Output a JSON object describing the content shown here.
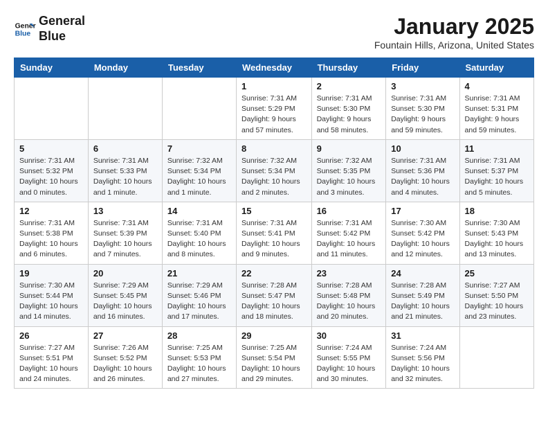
{
  "logo": {
    "line1": "General",
    "line2": "Blue"
  },
  "title": "January 2025",
  "subtitle": "Fountain Hills, Arizona, United States",
  "weekdays": [
    "Sunday",
    "Monday",
    "Tuesday",
    "Wednesday",
    "Thursday",
    "Friday",
    "Saturday"
  ],
  "weeks": [
    [
      {
        "day": "",
        "info": ""
      },
      {
        "day": "",
        "info": ""
      },
      {
        "day": "",
        "info": ""
      },
      {
        "day": "1",
        "info": "Sunrise: 7:31 AM\nSunset: 5:29 PM\nDaylight: 9 hours and 57 minutes."
      },
      {
        "day": "2",
        "info": "Sunrise: 7:31 AM\nSunset: 5:30 PM\nDaylight: 9 hours and 58 minutes."
      },
      {
        "day": "3",
        "info": "Sunrise: 7:31 AM\nSunset: 5:30 PM\nDaylight: 9 hours and 59 minutes."
      },
      {
        "day": "4",
        "info": "Sunrise: 7:31 AM\nSunset: 5:31 PM\nDaylight: 9 hours and 59 minutes."
      }
    ],
    [
      {
        "day": "5",
        "info": "Sunrise: 7:31 AM\nSunset: 5:32 PM\nDaylight: 10 hours and 0 minutes."
      },
      {
        "day": "6",
        "info": "Sunrise: 7:31 AM\nSunset: 5:33 PM\nDaylight: 10 hours and 1 minute."
      },
      {
        "day": "7",
        "info": "Sunrise: 7:32 AM\nSunset: 5:34 PM\nDaylight: 10 hours and 1 minute."
      },
      {
        "day": "8",
        "info": "Sunrise: 7:32 AM\nSunset: 5:34 PM\nDaylight: 10 hours and 2 minutes."
      },
      {
        "day": "9",
        "info": "Sunrise: 7:32 AM\nSunset: 5:35 PM\nDaylight: 10 hours and 3 minutes."
      },
      {
        "day": "10",
        "info": "Sunrise: 7:31 AM\nSunset: 5:36 PM\nDaylight: 10 hours and 4 minutes."
      },
      {
        "day": "11",
        "info": "Sunrise: 7:31 AM\nSunset: 5:37 PM\nDaylight: 10 hours and 5 minutes."
      }
    ],
    [
      {
        "day": "12",
        "info": "Sunrise: 7:31 AM\nSunset: 5:38 PM\nDaylight: 10 hours and 6 minutes."
      },
      {
        "day": "13",
        "info": "Sunrise: 7:31 AM\nSunset: 5:39 PM\nDaylight: 10 hours and 7 minutes."
      },
      {
        "day": "14",
        "info": "Sunrise: 7:31 AM\nSunset: 5:40 PM\nDaylight: 10 hours and 8 minutes."
      },
      {
        "day": "15",
        "info": "Sunrise: 7:31 AM\nSunset: 5:41 PM\nDaylight: 10 hours and 9 minutes."
      },
      {
        "day": "16",
        "info": "Sunrise: 7:31 AM\nSunset: 5:42 PM\nDaylight: 10 hours and 11 minutes."
      },
      {
        "day": "17",
        "info": "Sunrise: 7:30 AM\nSunset: 5:42 PM\nDaylight: 10 hours and 12 minutes."
      },
      {
        "day": "18",
        "info": "Sunrise: 7:30 AM\nSunset: 5:43 PM\nDaylight: 10 hours and 13 minutes."
      }
    ],
    [
      {
        "day": "19",
        "info": "Sunrise: 7:30 AM\nSunset: 5:44 PM\nDaylight: 10 hours and 14 minutes."
      },
      {
        "day": "20",
        "info": "Sunrise: 7:29 AM\nSunset: 5:45 PM\nDaylight: 10 hours and 16 minutes."
      },
      {
        "day": "21",
        "info": "Sunrise: 7:29 AM\nSunset: 5:46 PM\nDaylight: 10 hours and 17 minutes."
      },
      {
        "day": "22",
        "info": "Sunrise: 7:28 AM\nSunset: 5:47 PM\nDaylight: 10 hours and 18 minutes."
      },
      {
        "day": "23",
        "info": "Sunrise: 7:28 AM\nSunset: 5:48 PM\nDaylight: 10 hours and 20 minutes."
      },
      {
        "day": "24",
        "info": "Sunrise: 7:28 AM\nSunset: 5:49 PM\nDaylight: 10 hours and 21 minutes."
      },
      {
        "day": "25",
        "info": "Sunrise: 7:27 AM\nSunset: 5:50 PM\nDaylight: 10 hours and 23 minutes."
      }
    ],
    [
      {
        "day": "26",
        "info": "Sunrise: 7:27 AM\nSunset: 5:51 PM\nDaylight: 10 hours and 24 minutes."
      },
      {
        "day": "27",
        "info": "Sunrise: 7:26 AM\nSunset: 5:52 PM\nDaylight: 10 hours and 26 minutes."
      },
      {
        "day": "28",
        "info": "Sunrise: 7:25 AM\nSunset: 5:53 PM\nDaylight: 10 hours and 27 minutes."
      },
      {
        "day": "29",
        "info": "Sunrise: 7:25 AM\nSunset: 5:54 PM\nDaylight: 10 hours and 29 minutes."
      },
      {
        "day": "30",
        "info": "Sunrise: 7:24 AM\nSunset: 5:55 PM\nDaylight: 10 hours and 30 minutes."
      },
      {
        "day": "31",
        "info": "Sunrise: 7:24 AM\nSunset: 5:56 PM\nDaylight: 10 hours and 32 minutes."
      },
      {
        "day": "",
        "info": ""
      }
    ]
  ]
}
